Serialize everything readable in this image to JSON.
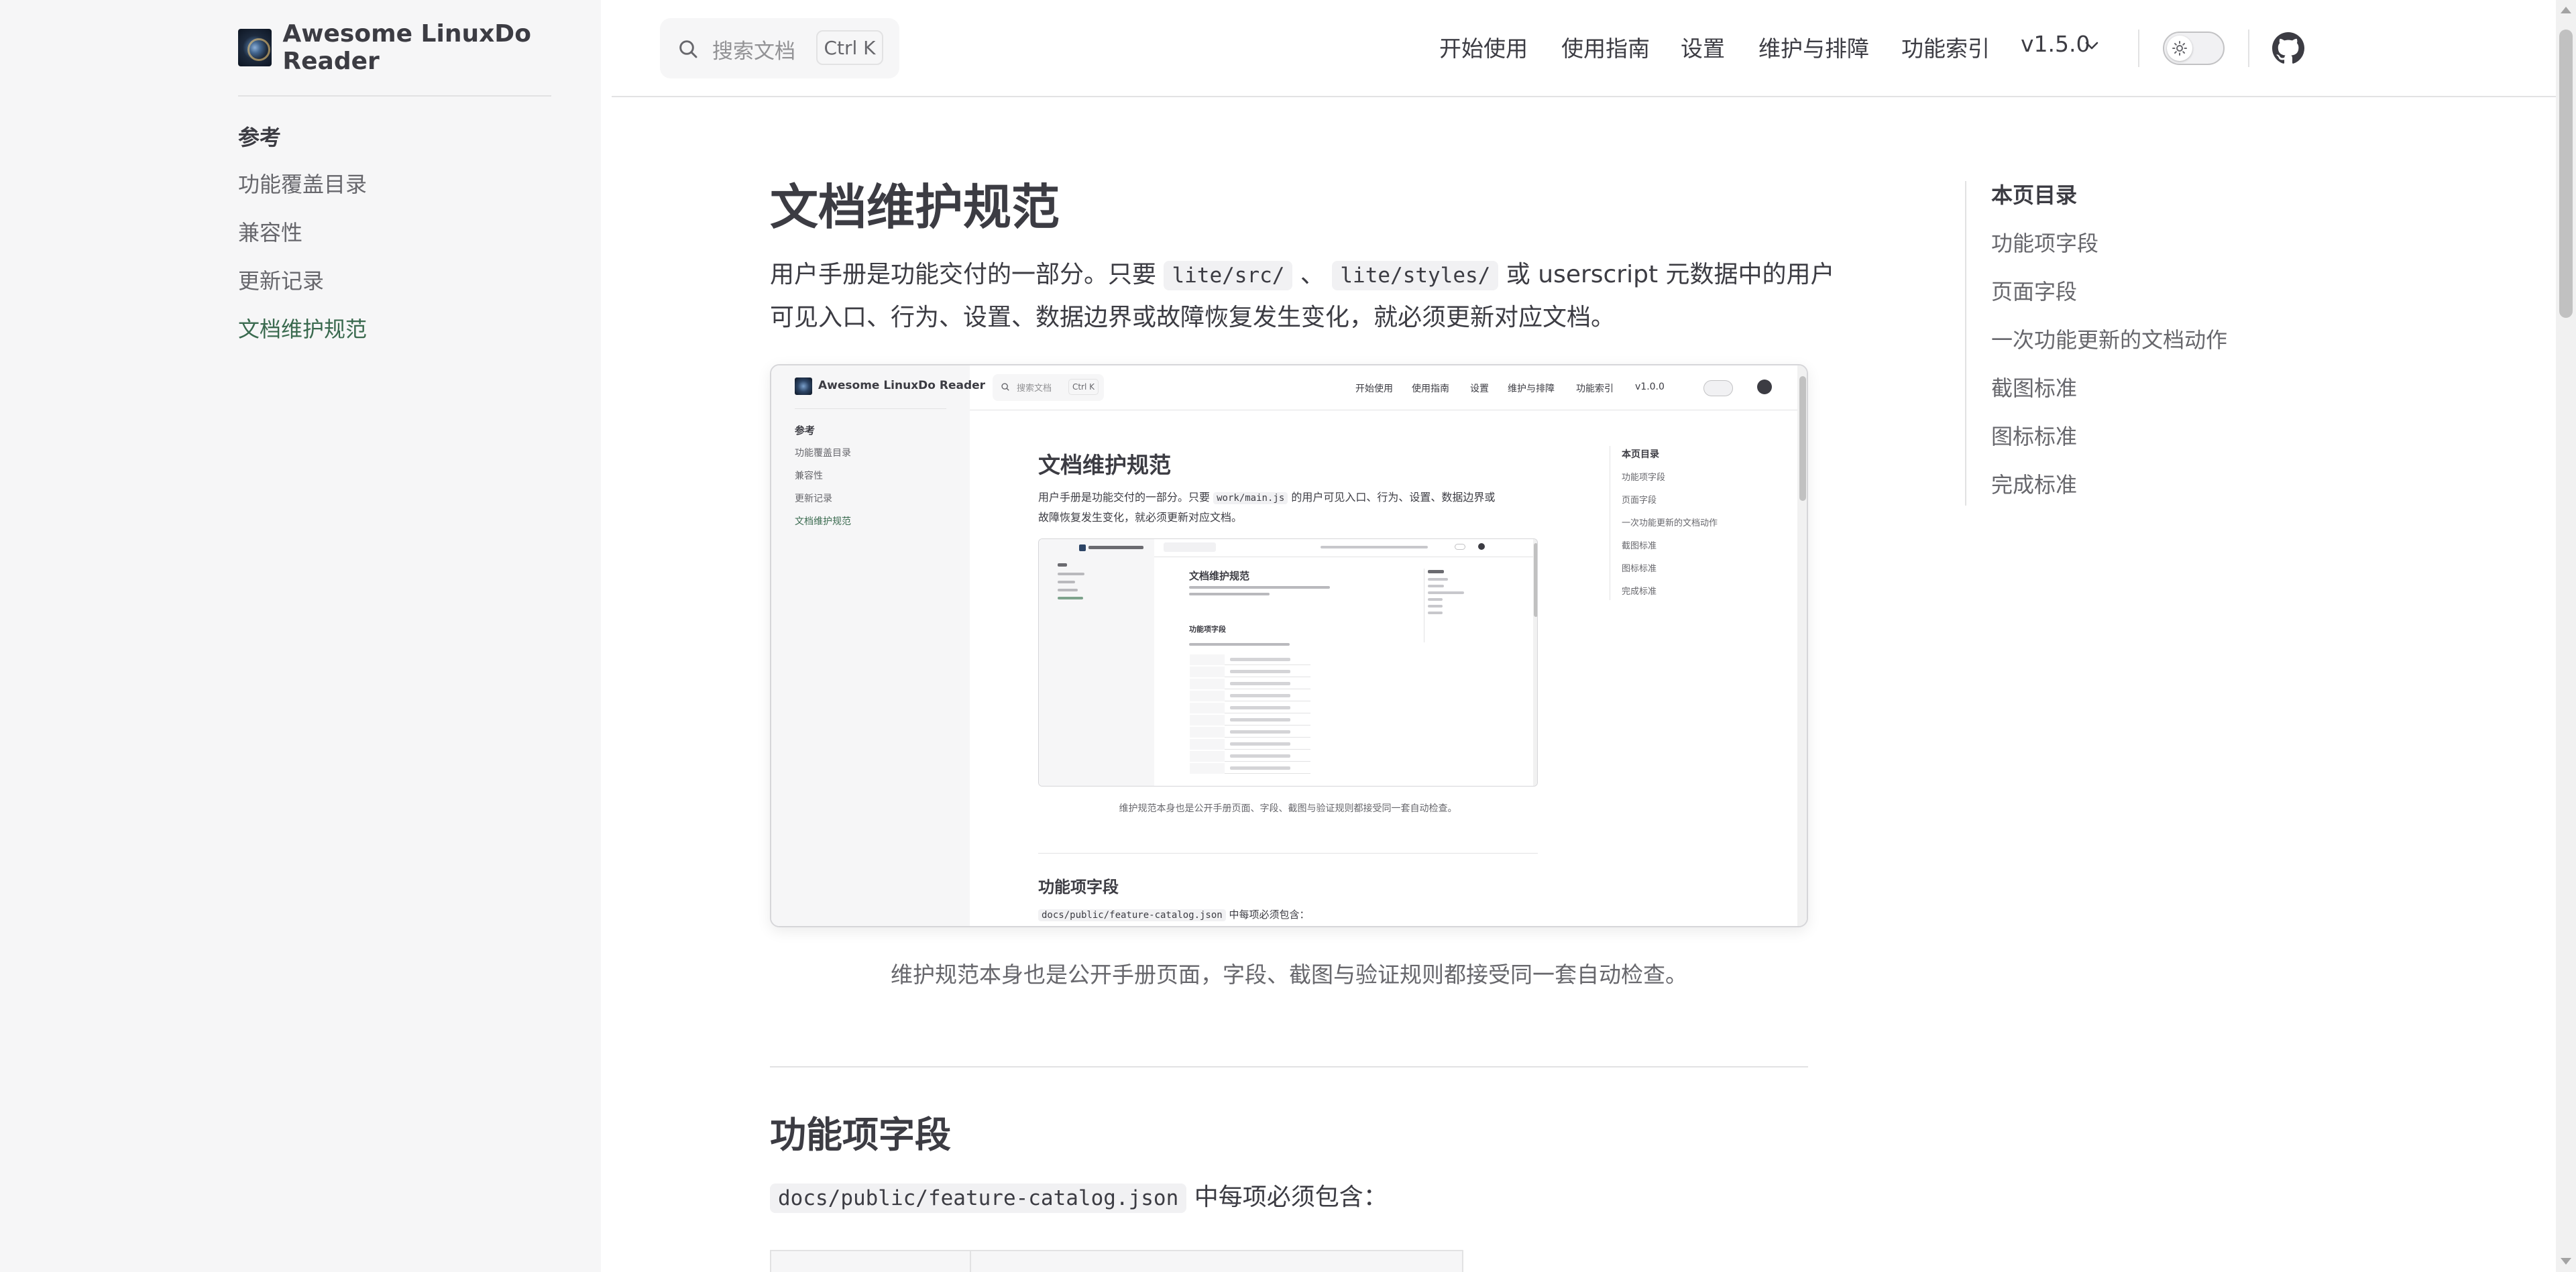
{
  "brand": {
    "name": "Awesome LinuxDo Reader"
  },
  "sidebar": {
    "group_title": "参考",
    "items": [
      {
        "label": "功能覆盖目录",
        "active": false
      },
      {
        "label": "兼容性",
        "active": false
      },
      {
        "label": "更新记录",
        "active": false
      },
      {
        "label": "文档维护规范",
        "active": true
      }
    ]
  },
  "search": {
    "placeholder": "搜索文档",
    "shortcut": "Ctrl K"
  },
  "nav": {
    "links": [
      "开始使用",
      "使用指南",
      "设置",
      "维护与排障",
      "功能索引"
    ],
    "version": "v1.5.0"
  },
  "doc": {
    "title": "文档维护规范",
    "intro_part1": "用户手册是功能交付的一部分。只要",
    "code1": "lite/src/",
    "sep": "、",
    "code2": "lite/styles/",
    "intro_part2": "或 userscript 元数据中的用户",
    "intro_line2": "可见入口、行为、设置、数据边界或故障恢复发生变化，就必须更新对应文档。",
    "caption": "维护规范本身也是公开手册页面，字段、截图与验证规则都接受同一套自动检查。",
    "section_title": "功能项字段",
    "section_code": "docs/public/feature-catalog.json",
    "section_text": "中每项必须包含："
  },
  "outline": {
    "title": "本页目录",
    "items": [
      "功能项字段",
      "页面字段",
      "一次功能更新的文档动作",
      "截图标准",
      "图标标准",
      "完成标准"
    ]
  },
  "nested": {
    "brand": "Awesome LinuxDo Reader",
    "group_title": "参考",
    "sidebar_items": [
      "功能覆盖目录",
      "兼容性",
      "更新记录",
      "文档维护规范"
    ],
    "search_placeholder": "搜索文档",
    "search_shortcut": "Ctrl K",
    "nav_links": [
      "开始使用",
      "使用指南",
      "设置",
      "维护与排障",
      "功能索引"
    ],
    "version": "v1.0.0",
    "title": "文档维护规范",
    "intro_part1": "用户手册是功能交付的一部分。只要",
    "code1": "work/main.js",
    "intro_part2": "的用户可见入口、行为、设置、数据边界或",
    "intro_line2": "故障恢复发生变化，就必须更新对应文档。",
    "caption": "维护规范本身也是公开手册页面、字段、截图与验证规则都接受同一套自动检查。",
    "section_title": "功能项字段",
    "section_code": "docs/public/feature-catalog.json",
    "section_text": "中每项必须包含：",
    "outline_title": "本页目录",
    "outline_items": [
      "功能项字段",
      "页面字段",
      "一次功能更新的文档动作",
      "截图标准",
      "图标标准",
      "完成标准"
    ]
  },
  "nested2": {
    "title": "文档维护规范",
    "section_title": "功能项字段"
  }
}
